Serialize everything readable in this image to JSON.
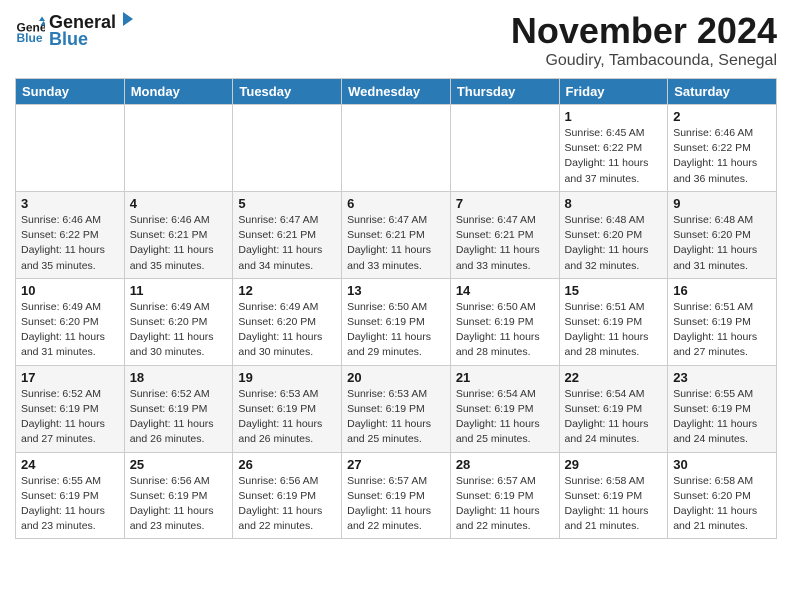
{
  "header": {
    "logo_line1": "General",
    "logo_line2": "Blue",
    "month_title": "November 2024",
    "location": "Goudiry, Tambacounda, Senegal"
  },
  "calendar": {
    "days_of_week": [
      "Sunday",
      "Monday",
      "Tuesday",
      "Wednesday",
      "Thursday",
      "Friday",
      "Saturday"
    ],
    "weeks": [
      [
        {
          "day": "",
          "info": ""
        },
        {
          "day": "",
          "info": ""
        },
        {
          "day": "",
          "info": ""
        },
        {
          "day": "",
          "info": ""
        },
        {
          "day": "",
          "info": ""
        },
        {
          "day": "1",
          "info": "Sunrise: 6:45 AM\nSunset: 6:22 PM\nDaylight: 11 hours\nand 37 minutes."
        },
        {
          "day": "2",
          "info": "Sunrise: 6:46 AM\nSunset: 6:22 PM\nDaylight: 11 hours\nand 36 minutes."
        }
      ],
      [
        {
          "day": "3",
          "info": "Sunrise: 6:46 AM\nSunset: 6:22 PM\nDaylight: 11 hours\nand 35 minutes."
        },
        {
          "day": "4",
          "info": "Sunrise: 6:46 AM\nSunset: 6:21 PM\nDaylight: 11 hours\nand 35 minutes."
        },
        {
          "day": "5",
          "info": "Sunrise: 6:47 AM\nSunset: 6:21 PM\nDaylight: 11 hours\nand 34 minutes."
        },
        {
          "day": "6",
          "info": "Sunrise: 6:47 AM\nSunset: 6:21 PM\nDaylight: 11 hours\nand 33 minutes."
        },
        {
          "day": "7",
          "info": "Sunrise: 6:47 AM\nSunset: 6:21 PM\nDaylight: 11 hours\nand 33 minutes."
        },
        {
          "day": "8",
          "info": "Sunrise: 6:48 AM\nSunset: 6:20 PM\nDaylight: 11 hours\nand 32 minutes."
        },
        {
          "day": "9",
          "info": "Sunrise: 6:48 AM\nSunset: 6:20 PM\nDaylight: 11 hours\nand 31 minutes."
        }
      ],
      [
        {
          "day": "10",
          "info": "Sunrise: 6:49 AM\nSunset: 6:20 PM\nDaylight: 11 hours\nand 31 minutes."
        },
        {
          "day": "11",
          "info": "Sunrise: 6:49 AM\nSunset: 6:20 PM\nDaylight: 11 hours\nand 30 minutes."
        },
        {
          "day": "12",
          "info": "Sunrise: 6:49 AM\nSunset: 6:20 PM\nDaylight: 11 hours\nand 30 minutes."
        },
        {
          "day": "13",
          "info": "Sunrise: 6:50 AM\nSunset: 6:19 PM\nDaylight: 11 hours\nand 29 minutes."
        },
        {
          "day": "14",
          "info": "Sunrise: 6:50 AM\nSunset: 6:19 PM\nDaylight: 11 hours\nand 28 minutes."
        },
        {
          "day": "15",
          "info": "Sunrise: 6:51 AM\nSunset: 6:19 PM\nDaylight: 11 hours\nand 28 minutes."
        },
        {
          "day": "16",
          "info": "Sunrise: 6:51 AM\nSunset: 6:19 PM\nDaylight: 11 hours\nand 27 minutes."
        }
      ],
      [
        {
          "day": "17",
          "info": "Sunrise: 6:52 AM\nSunset: 6:19 PM\nDaylight: 11 hours\nand 27 minutes."
        },
        {
          "day": "18",
          "info": "Sunrise: 6:52 AM\nSunset: 6:19 PM\nDaylight: 11 hours\nand 26 minutes."
        },
        {
          "day": "19",
          "info": "Sunrise: 6:53 AM\nSunset: 6:19 PM\nDaylight: 11 hours\nand 26 minutes."
        },
        {
          "day": "20",
          "info": "Sunrise: 6:53 AM\nSunset: 6:19 PM\nDaylight: 11 hours\nand 25 minutes."
        },
        {
          "day": "21",
          "info": "Sunrise: 6:54 AM\nSunset: 6:19 PM\nDaylight: 11 hours\nand 25 minutes."
        },
        {
          "day": "22",
          "info": "Sunrise: 6:54 AM\nSunset: 6:19 PM\nDaylight: 11 hours\nand 24 minutes."
        },
        {
          "day": "23",
          "info": "Sunrise: 6:55 AM\nSunset: 6:19 PM\nDaylight: 11 hours\nand 24 minutes."
        }
      ],
      [
        {
          "day": "24",
          "info": "Sunrise: 6:55 AM\nSunset: 6:19 PM\nDaylight: 11 hours\nand 23 minutes."
        },
        {
          "day": "25",
          "info": "Sunrise: 6:56 AM\nSunset: 6:19 PM\nDaylight: 11 hours\nand 23 minutes."
        },
        {
          "day": "26",
          "info": "Sunrise: 6:56 AM\nSunset: 6:19 PM\nDaylight: 11 hours\nand 22 minutes."
        },
        {
          "day": "27",
          "info": "Sunrise: 6:57 AM\nSunset: 6:19 PM\nDaylight: 11 hours\nand 22 minutes."
        },
        {
          "day": "28",
          "info": "Sunrise: 6:57 AM\nSunset: 6:19 PM\nDaylight: 11 hours\nand 22 minutes."
        },
        {
          "day": "29",
          "info": "Sunrise: 6:58 AM\nSunset: 6:19 PM\nDaylight: 11 hours\nand 21 minutes."
        },
        {
          "day": "30",
          "info": "Sunrise: 6:58 AM\nSunset: 6:20 PM\nDaylight: 11 hours\nand 21 minutes."
        }
      ]
    ]
  }
}
